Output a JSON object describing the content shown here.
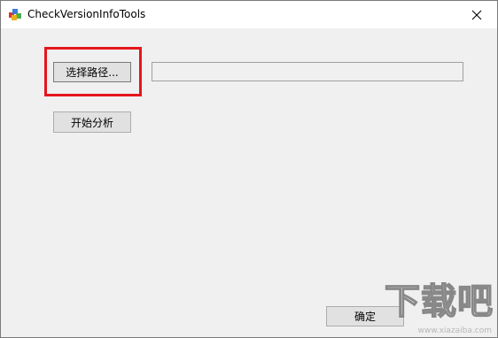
{
  "window": {
    "title": "CheckVersionInfoTools",
    "close_glyph": "✕",
    "app_icon": "colored-cubes-icon"
  },
  "main": {
    "select_path_label": "选择路径...",
    "path_value": "",
    "start_analysis_label": "开始分析",
    "ok_label": "确定"
  },
  "watermark": {
    "text": "下载吧",
    "url": "www.xiazaiba.com"
  },
  "colors": {
    "highlight": "#e5161c",
    "client_bg": "#f0f0f0",
    "button_bg": "#e1e1e1"
  }
}
